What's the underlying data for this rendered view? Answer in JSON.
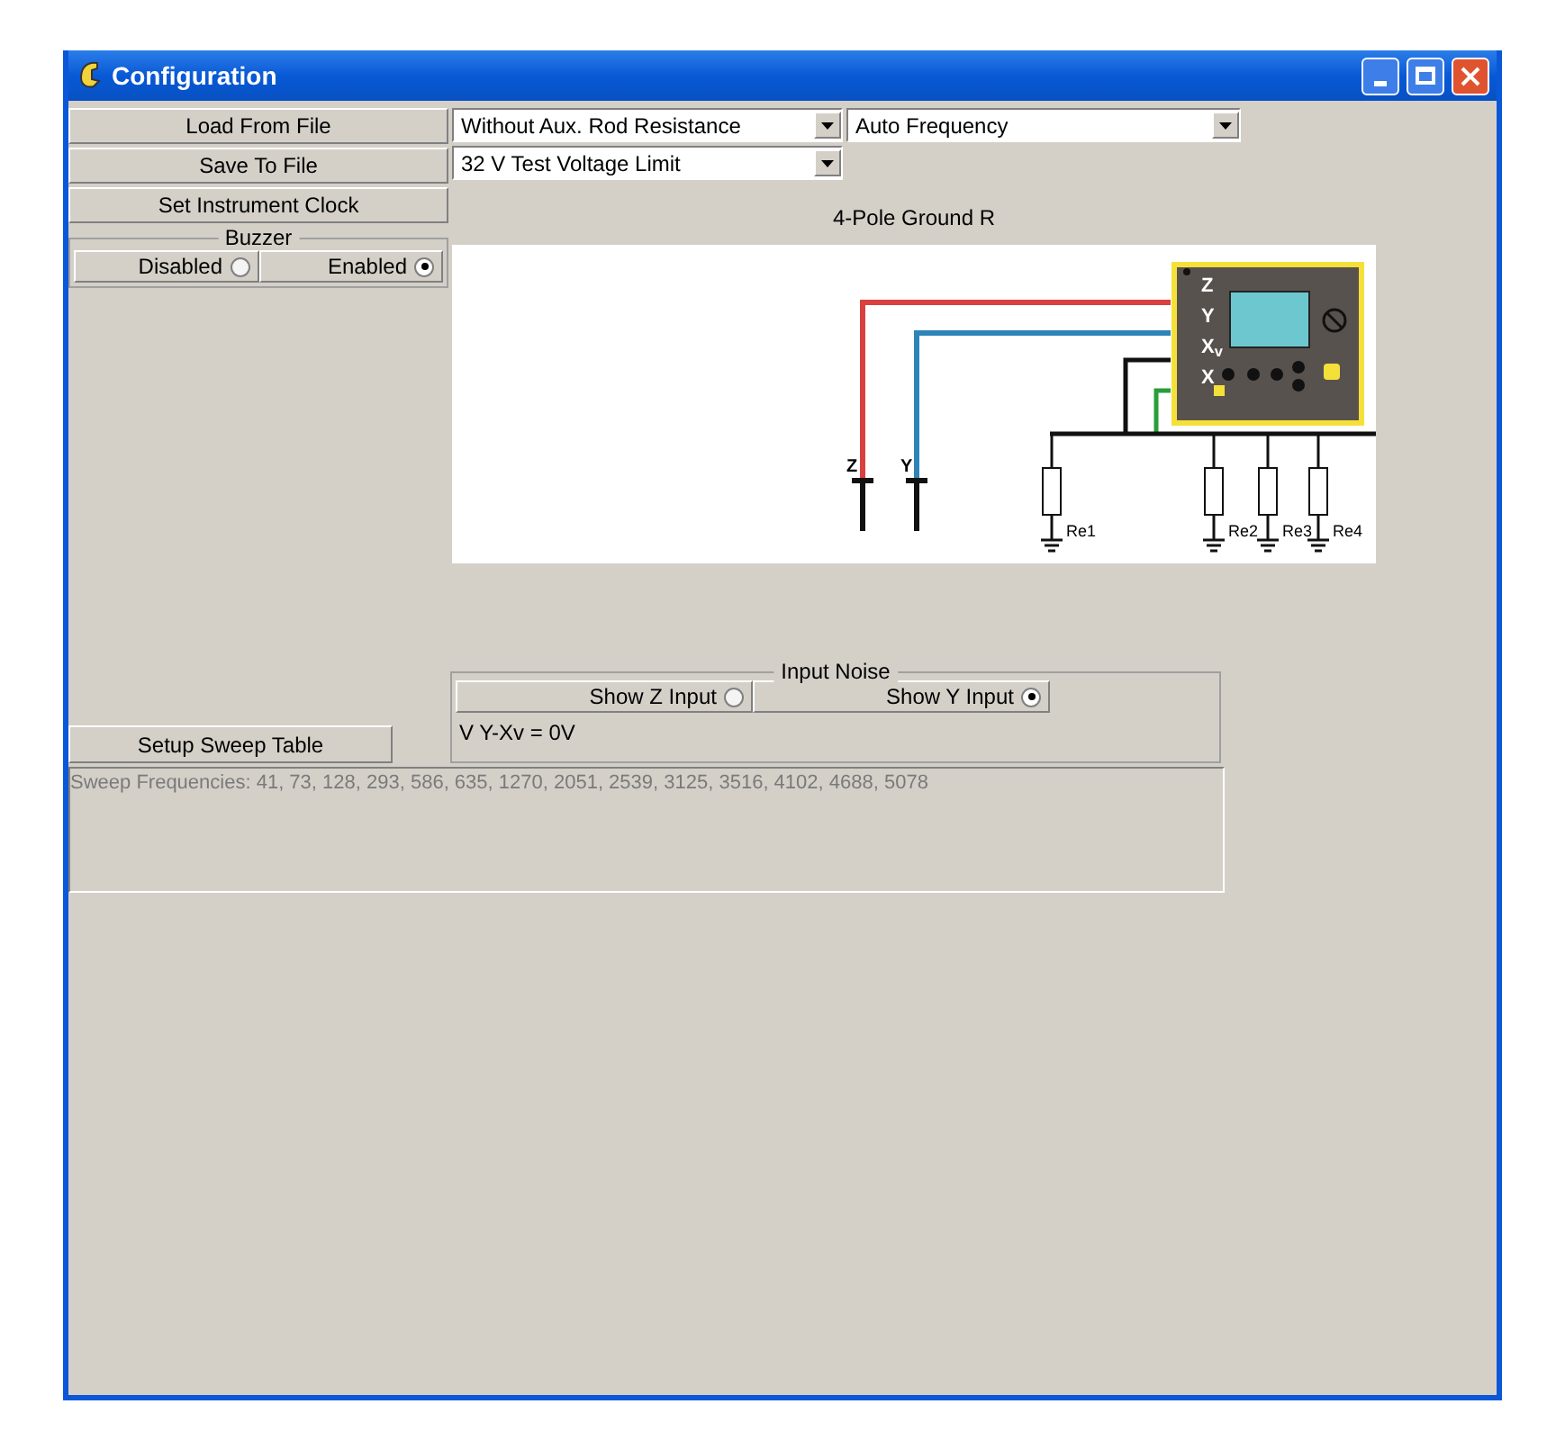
{
  "window": {
    "title": "Configuration"
  },
  "left_buttons": [
    "Load From File",
    "Save To File",
    "Set Instrument Clock"
  ],
  "buzzer": {
    "label": "Buzzer",
    "options": [
      {
        "label": "Disabled",
        "selected": false
      },
      {
        "label": "Enabled",
        "selected": true
      }
    ]
  },
  "dropdowns": [
    {
      "value": "Without Aux. Rod Resistance"
    },
    {
      "value": "Auto Frequency"
    },
    {
      "value": "32 V Test Voltage Limit"
    }
  ],
  "diagram": {
    "title": "4-Pole Ground R",
    "terminal_labels": [
      "Z",
      "Y",
      "X$_{v}$",
      "X"
    ],
    "stake_labels": [
      "Z",
      "Y"
    ],
    "resistor_labels": [
      "Re1",
      "Re2",
      "Re3",
      "Re4"
    ]
  },
  "input_noise": {
    "label": "Input Noise",
    "options": [
      {
        "label": "Show Z Input",
        "selected": false
      },
      {
        "label": "Show Y Input",
        "selected": true
      }
    ],
    "reading": "V Y-Xv = 0V"
  },
  "sweep": {
    "button": "Setup Sweep Table",
    "text": "Sweep Frequencies: 41, 73, 128, 293, 586, 635, 1270, 2051, 2539, 3125, 3516, 4102, 4688, 5078"
  }
}
